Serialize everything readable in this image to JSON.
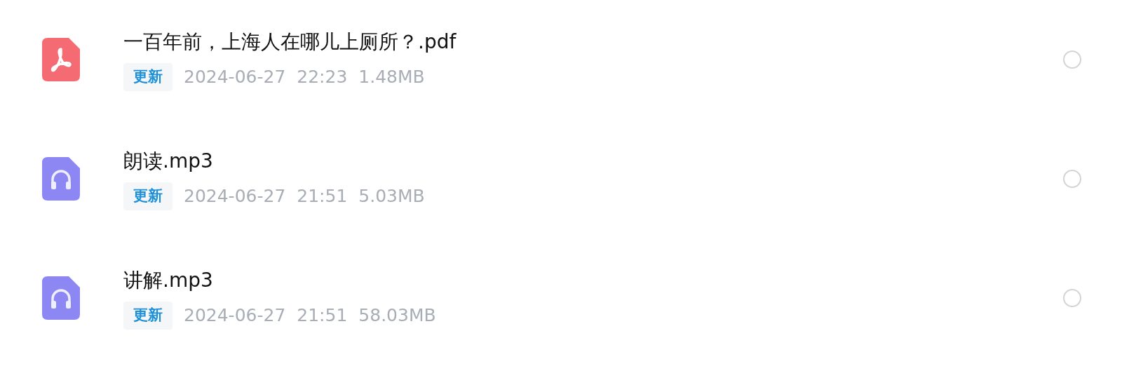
{
  "files": [
    {
      "kind": "pdf",
      "name": "一百年前，上海人在哪儿上厕所？.pdf",
      "badge": "更新",
      "date": "2024-06-27",
      "time": "22:23",
      "size": "1.48MB",
      "selected": false
    },
    {
      "kind": "audio",
      "name": "朗读.mp3",
      "badge": "更新",
      "date": "2024-06-27",
      "time": "21:51",
      "size": "5.03MB",
      "selected": false
    },
    {
      "kind": "audio",
      "name": "讲解.mp3",
      "badge": "更新",
      "date": "2024-06-27",
      "time": "21:51",
      "size": "58.03MB",
      "selected": false
    }
  ]
}
